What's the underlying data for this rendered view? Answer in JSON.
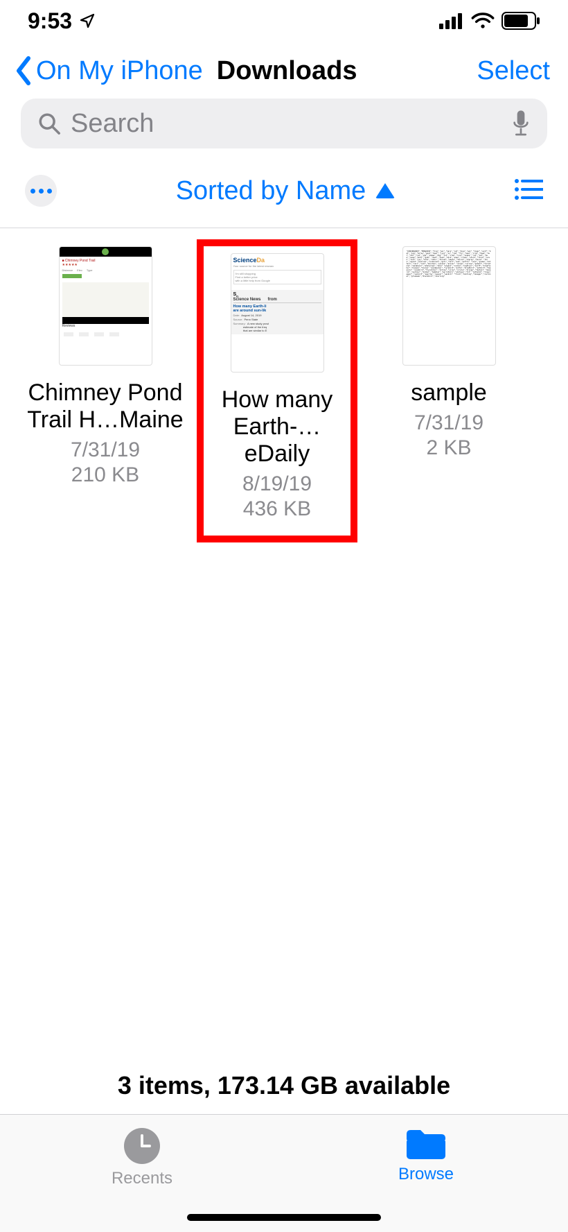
{
  "status": {
    "time": "9:53"
  },
  "nav": {
    "back_label": "On My iPhone",
    "title": "Downloads",
    "select_label": "Select"
  },
  "search": {
    "placeholder": "Search"
  },
  "toolbar": {
    "sort_label": "Sorted by Name"
  },
  "files": [
    {
      "name": "Chimney Pond Trail H…Maine",
      "date": "7/31/19",
      "size": "210 KB",
      "highlighted": false
    },
    {
      "name": "How many Earth-…eDaily",
      "date": "8/19/19",
      "size": "436 KB",
      "highlighted": true
    },
    {
      "name": "sample",
      "date": "7/31/19",
      "size": "2 KB",
      "highlighted": false
    }
  ],
  "summary": "3 items, 173.14 GB available",
  "tabs": {
    "recents": "Recents",
    "browse": "Browse"
  }
}
